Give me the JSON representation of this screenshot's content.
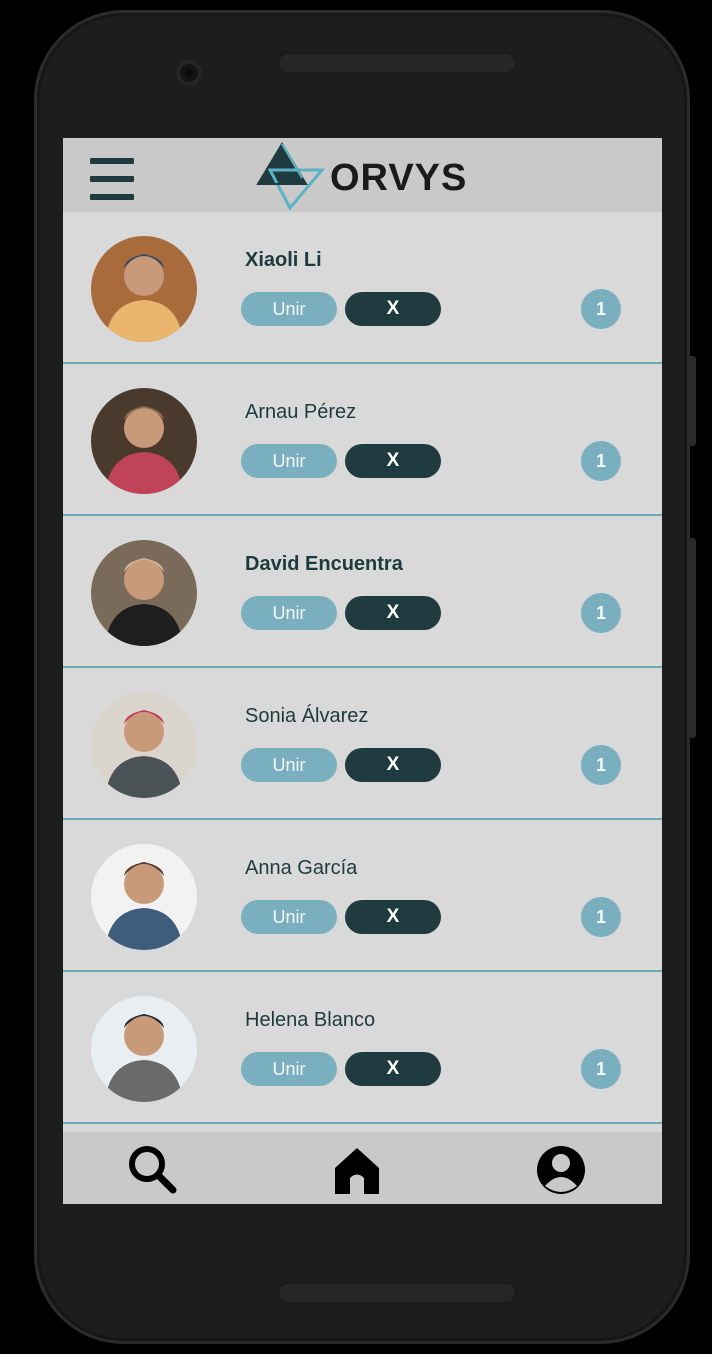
{
  "app": {
    "brand": "ORVYS"
  },
  "header": {
    "menu_icon": "hamburger-menu-icon",
    "logo_icon": "orvys-triangle-logo"
  },
  "contacts": [
    {
      "name": "Xiaoli Li",
      "bold": true,
      "join_label": "Unir",
      "dismiss_label": "X",
      "badge": "1",
      "avatar_colors": [
        "#a86b3c",
        "#e9b56f",
        "#3c4b5e"
      ]
    },
    {
      "name": "Arnau Pérez",
      "bold": false,
      "join_label": "Unir",
      "dismiss_label": "X",
      "badge": "1",
      "avatar_colors": [
        "#4a3a2e",
        "#c0435a",
        "#8b6a4f"
      ]
    },
    {
      "name": "David Encuentra",
      "bold": true,
      "join_label": "Unir",
      "dismiss_label": "X",
      "badge": "1",
      "avatar_colors": [
        "#7a6a5a",
        "#1e1e1e",
        "#c9b59a"
      ]
    },
    {
      "name": "Sonia Álvarez",
      "bold": false,
      "join_label": "Unir",
      "dismiss_label": "X",
      "badge": "1",
      "avatar_colors": [
        "#d9d4cc",
        "#4b5357",
        "#c2405a"
      ]
    },
    {
      "name": "Anna García",
      "bold": false,
      "join_label": "Unir",
      "dismiss_label": "X",
      "badge": "1",
      "avatar_colors": [
        "#f2f2f2",
        "#3e5d7c",
        "#5a3a2a"
      ]
    },
    {
      "name": "Helena Blanco",
      "bold": false,
      "join_label": "Unir",
      "dismiss_label": "X",
      "badge": "1",
      "avatar_colors": [
        "#e9eef2",
        "#6a6a6a",
        "#2a2a2a"
      ]
    }
  ],
  "bottom_nav": {
    "items": [
      {
        "icon": "search-icon"
      },
      {
        "icon": "home-icon"
      },
      {
        "icon": "profile-icon"
      }
    ]
  },
  "colors": {
    "accent": "#7aafbf",
    "dark": "#1f3b3f",
    "background": "#d9d9d9",
    "bar": "#c9c9c9",
    "divider": "#6fa8b6"
  }
}
